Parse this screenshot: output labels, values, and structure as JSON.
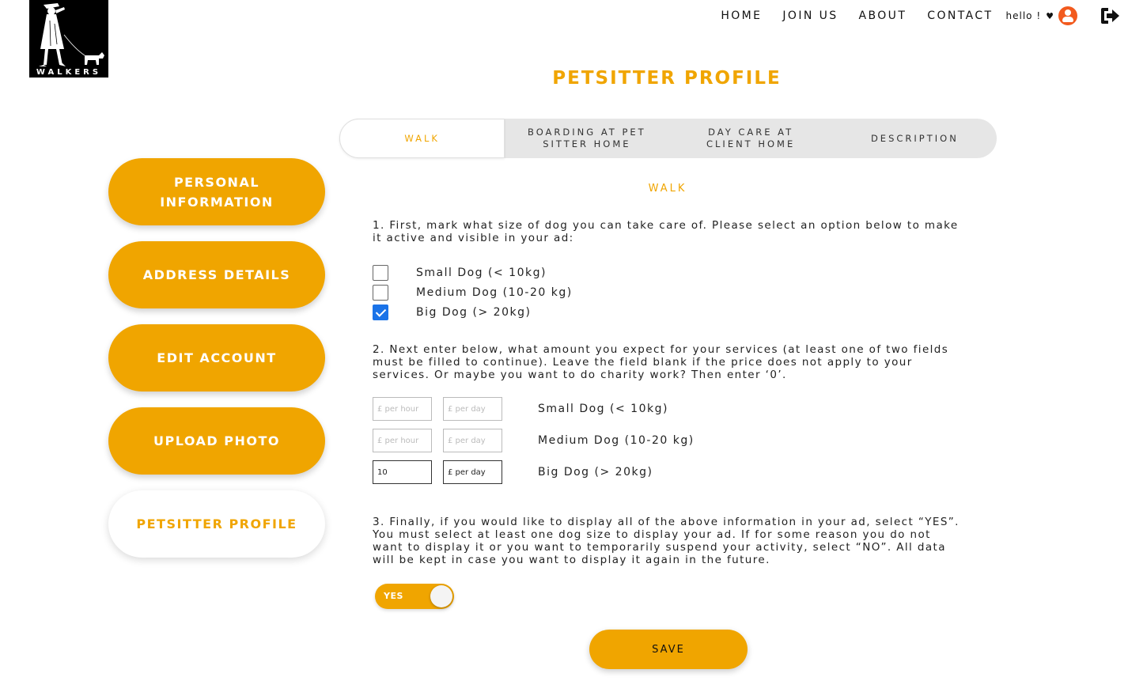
{
  "logo": {
    "text": "WALKERS"
  },
  "nav": {
    "links": [
      "HOME",
      "JOIN US",
      "ABOUT",
      "CONTACT"
    ],
    "greeting": "hello !",
    "heart": "♥"
  },
  "page": {
    "title": "PETSITTER PROFILE"
  },
  "sidebar": {
    "items": [
      {
        "label": "PERSONAL INFORMATION"
      },
      {
        "label": "ADDRESS DETAILS"
      },
      {
        "label": "EDIT ACCOUNT"
      },
      {
        "label": "UPLOAD PHOTO"
      },
      {
        "label": "PETSITTER PROFILE",
        "active": true
      }
    ]
  },
  "tabs": [
    {
      "label": "WALK",
      "active": true
    },
    {
      "label": "BOARDING AT PET SITTER HOME"
    },
    {
      "label": "DAY CARE AT CLIENT HOME"
    },
    {
      "label": "DESCRIPTION"
    }
  ],
  "section": {
    "title": "WALK"
  },
  "step1": {
    "text": "1. First, mark what size of dog you can take care of. Please select an option below to make it active and visible in your ad:"
  },
  "dog_sizes": [
    {
      "label": "Small Dog (< 10kg)",
      "checked": false
    },
    {
      "label": "Medium Dog (10-20 kg)",
      "checked": false
    },
    {
      "label": "Big Dog (> 20kg)",
      "checked": true
    }
  ],
  "step2": {
    "text": "2. Next enter below, what amount you expect for your services (at least one of two fields must be filled to continue). Leave the field blank if the price does not apply to your services. Or maybe you want to do charity work? Then enter ‘0’."
  },
  "prices": [
    {
      "label": "Small Dog (< 10kg)",
      "per_hour_value": "",
      "per_hour_placeholder": "£ per hour",
      "per_day_value": "",
      "per_day_placeholder": "£ per day"
    },
    {
      "label": "Medium Dog (10-20 kg)",
      "per_hour_value": "",
      "per_hour_placeholder": "£ per hour",
      "per_day_value": "",
      "per_day_placeholder": "£ per day"
    },
    {
      "label": "Big Dog (> 20kg)",
      "per_hour_value": "10",
      "per_hour_placeholder": "£ per hour",
      "per_day_value": "",
      "per_day_placeholder": "£ per day"
    }
  ],
  "step3": {
    "text": "3. Finally, if you would like to display all of the above information in your ad, select “YES”. You must select at least one dog size to display your ad. If for some reason you do not want to display it or you want to temporarily suspend your activity, select “NO”. All data will be kept in case you want to display it again in the future."
  },
  "toggle": {
    "label": "YES",
    "on": true
  },
  "save": {
    "label": "SAVE"
  },
  "colors": {
    "accent": "#f0a500",
    "user_icon": "#f25a1e",
    "checkbox": "#1a73e8"
  },
  "icons": {
    "user": "user-circle-icon",
    "logout": "logout-icon"
  }
}
